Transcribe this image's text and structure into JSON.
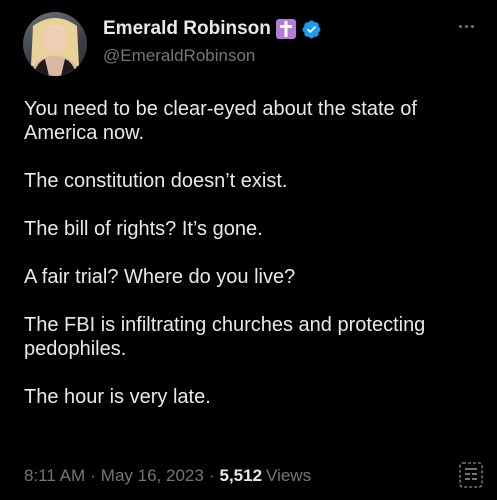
{
  "author": {
    "display_name": "Emerald Robinson",
    "handle": "@EmeraldRobinson"
  },
  "tweet": {
    "paragraphs": [
      "You need to be clear-eyed about the state of America now.",
      "The constitution doesn’t exist.",
      "The bill of rights? It’s gone.",
      "A fair trial? Where do you live?",
      "The FBI is infiltrating churches and protecting pedophiles.",
      "The hour is very late."
    ]
  },
  "footer": {
    "time": "8:11 AM",
    "separator": "·",
    "date": "May 16, 2023",
    "views_count": "5,512",
    "views_label": "Views"
  },
  "icons": {
    "cross_badge": "cross-icon",
    "verified": "verified-badge-icon",
    "more": "more-options-icon",
    "analytics": "analytics-icon"
  },
  "colors": {
    "background": "#000000",
    "text": "#e7e9ea",
    "secondary": "#71767b",
    "verified_blue": "#1d9bf0",
    "cross_badge": "#b37ad9"
  }
}
